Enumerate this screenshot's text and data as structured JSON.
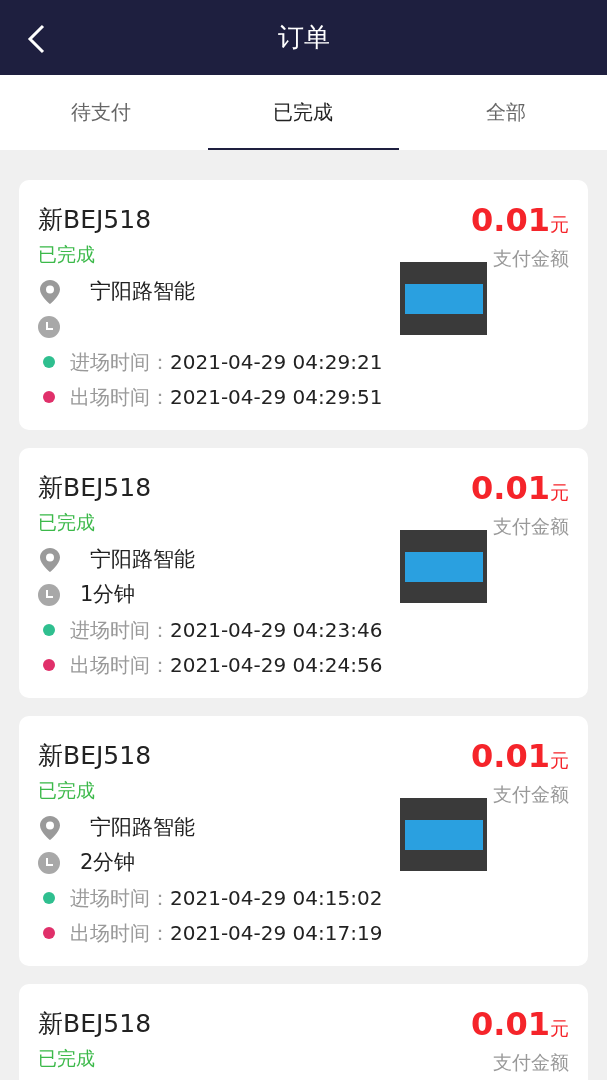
{
  "header": {
    "title": "订单"
  },
  "tabs": [
    {
      "label": "待支付",
      "selected": false
    },
    {
      "label": "已完成",
      "selected": true
    },
    {
      "label": "全部",
      "selected": false
    }
  ],
  "orders": [
    {
      "plate": "新BEJ518",
      "status": "已完成",
      "amount": "0.01",
      "currency": "元",
      "amount_label": "支付金额",
      "location": "宁阳路智能",
      "entry_label": "进场时间：",
      "entry_time": "2021-04-29 04:29:21",
      "exit_label": "出场时间：",
      "exit_time": "2021-04-29 04:29:51"
    },
    {
      "plate": "新BEJ518",
      "status": "已完成",
      "amount": "0.01",
      "currency": "元",
      "amount_label": "支付金额",
      "location": "宁阳路智能",
      "duration": "1分钟",
      "entry_label": "进场时间：",
      "entry_time": "2021-04-29 04:23:46",
      "exit_label": "出场时间：",
      "exit_time": "2021-04-29 04:24:56"
    },
    {
      "plate": "新BEJ518",
      "status": "已完成",
      "amount": "0.01",
      "currency": "元",
      "amount_label": "支付金额",
      "location": "宁阳路智能",
      "duration": "2分钟",
      "entry_label": "进场时间：",
      "entry_time": "2021-04-29 04:15:02",
      "exit_label": "出场时间：",
      "exit_time": "2021-04-29 04:17:19"
    },
    {
      "plate": "新BEJ518",
      "status": "已完成",
      "amount": "0.01",
      "currency": "元",
      "amount_label": "支付金额"
    }
  ]
}
